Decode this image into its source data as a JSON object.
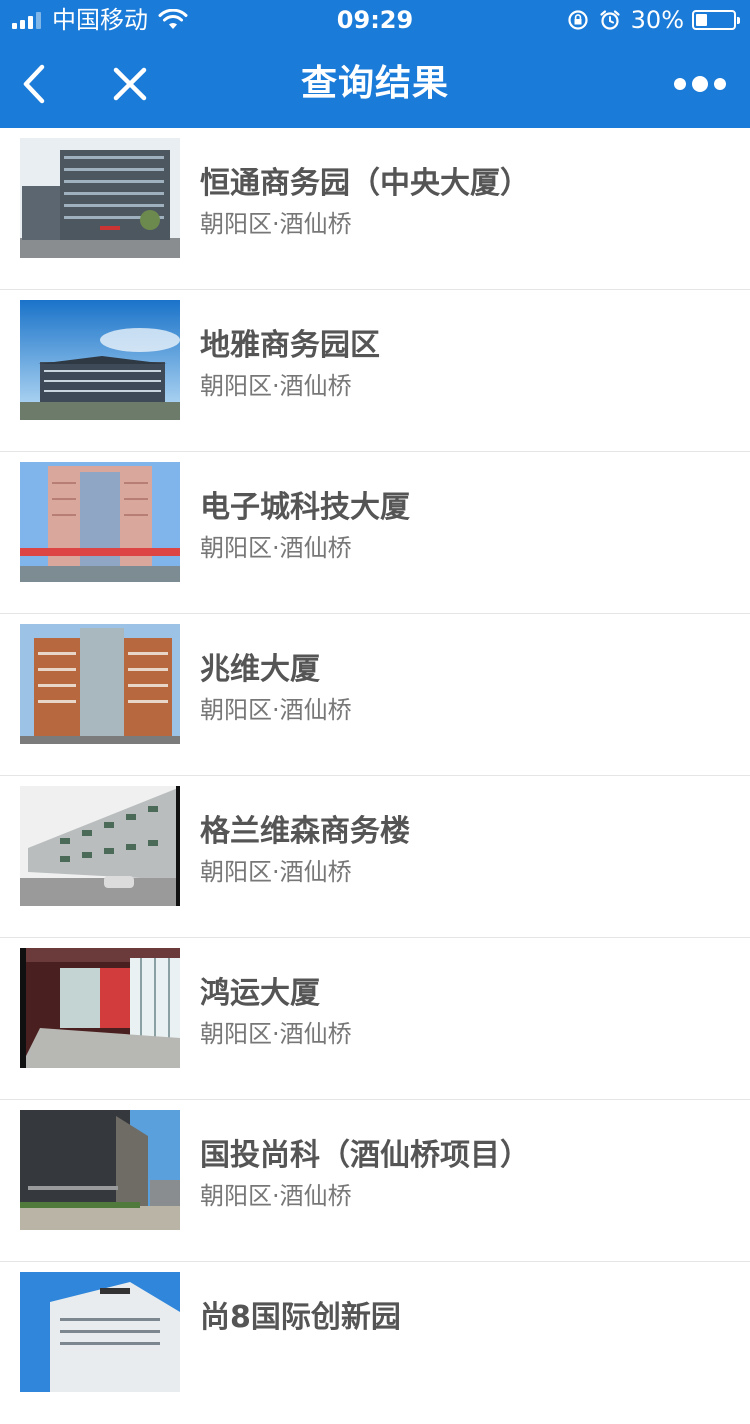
{
  "status_bar": {
    "carrier": "中国移动",
    "time": "09:29",
    "battery_text": "30%",
    "battery_level": 0.3
  },
  "nav": {
    "title": "查询结果",
    "back_icon": "chevron-left-icon",
    "close_icon": "close-icon",
    "more_icon": "more-dots-icon"
  },
  "colors": {
    "header_bg": "#1b7bd8",
    "title_text": "#555555",
    "subtitle_text": "#777777"
  },
  "results": [
    {
      "name": "恒通商务园（中央大厦）",
      "location": "朝阳区·酒仙桥"
    },
    {
      "name": "地雅商务园区",
      "location": "朝阳区·酒仙桥"
    },
    {
      "name": "电子城科技大厦",
      "location": "朝阳区·酒仙桥"
    },
    {
      "name": "兆维大厦",
      "location": "朝阳区·酒仙桥"
    },
    {
      "name": "格兰维森商务楼",
      "location": "朝阳区·酒仙桥"
    },
    {
      "name": "鸿运大厦",
      "location": "朝阳区·酒仙桥"
    },
    {
      "name": "国投尚科（酒仙桥项目）",
      "location": "朝阳区·酒仙桥"
    },
    {
      "name": "尚8国际创新园",
      "location": ""
    }
  ]
}
